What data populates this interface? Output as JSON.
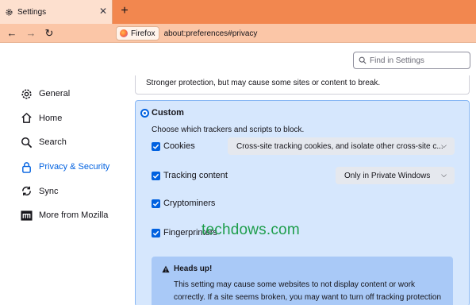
{
  "tab": {
    "title": "Settings",
    "close_glyph": "✕"
  },
  "newtab_glyph": "+",
  "nav": {
    "back_glyph": "←",
    "forward_glyph": "→",
    "reload_glyph": "↻"
  },
  "identity": {
    "label": "Firefox"
  },
  "url": "about:preferences#privacy",
  "search": {
    "placeholder": "Find in Settings"
  },
  "sidebar": {
    "items": [
      {
        "label": "General",
        "icon": "gear-icon"
      },
      {
        "label": "Home",
        "icon": "home-icon"
      },
      {
        "label": "Search",
        "icon": "search-icon"
      },
      {
        "label": "Privacy & Security",
        "icon": "lock-icon",
        "active": true
      },
      {
        "label": "Sync",
        "icon": "sync-icon"
      },
      {
        "label": "More from Mozilla",
        "icon": "mozilla-icon"
      }
    ]
  },
  "main": {
    "prev_text": "Stronger protection, but may cause some sites or content to break.",
    "custom": {
      "title": "Custom",
      "description": "Choose which trackers and scripts to block.",
      "options": [
        {
          "label": "Cookies",
          "checked": true,
          "dropdown": "Cross-site tracking cookies, and isolate other cross-site c..."
        },
        {
          "label": "Tracking content",
          "checked": true,
          "dropdown": "Only in Private Windows"
        },
        {
          "label": "Cryptominers",
          "checked": true
        },
        {
          "label": "Fingerprinters",
          "checked": true
        }
      ],
      "warning": {
        "title": "Heads up!",
        "text": "This setting may cause some websites to not display content or work correctly. If a site seems broken, you may want to turn off tracking protection for that site to"
      }
    }
  },
  "watermark": "techdows.com",
  "colors": {
    "tabstrip": "#f2874f",
    "navbar": "#fbc6a7",
    "accent": "#0061e0",
    "custom_bg": "#d6e7fd",
    "warning_bg": "#a9c9f7",
    "watermark": "#1e9e4c"
  }
}
